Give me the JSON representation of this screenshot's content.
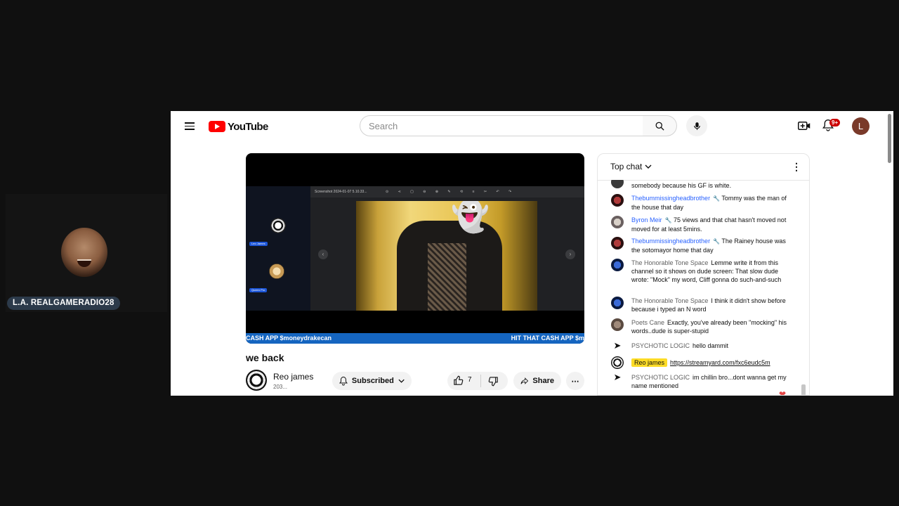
{
  "webcam": {
    "name": "L.A. REALGAMERADIO28"
  },
  "header": {
    "logo": "YouTube",
    "search_placeholder": "Search",
    "notifications": "9+",
    "avatar_letter": "L"
  },
  "video": {
    "screenshot_title": "Screenshot 2024-01-07 5.10.33...",
    "side_labels": [
      "Leo James",
      "Queen Pro"
    ],
    "ticker_left": "CASH APP $moneydrakecan",
    "ticker_right": "HIT THAT CASH APP $m",
    "title": "we back",
    "channel": "Reo james",
    "subs": "203...",
    "subscribe_label": "Subscribed",
    "likes": "7",
    "share_label": "Share"
  },
  "chat": {
    "title": "Top chat",
    "messages": [
      {
        "author": "",
        "text": "somebody because his GF is white."
      },
      {
        "author": "Thebummissingheadbrother",
        "mod": true,
        "text": "Tommy was the man of the house that day"
      },
      {
        "author": "Byron Meir",
        "mod": true,
        "text": "75 views and that chat hasn't moved not moved for at least 5mins."
      },
      {
        "author": "Thebummissingheadbrother",
        "mod": true,
        "text": "The Rainey house was the sotomayor home that day"
      },
      {
        "author": "The Honorable Tone Space",
        "text": "Lemme write it from this channel so it shows on dude screen: That slow dude wrote: \"Mock\" my word, Cliff gonna do such-and-such"
      },
      {
        "author": "The Honorable Tone Space",
        "text": "I think it didn't show before because i typed an N word"
      },
      {
        "author": "Poets Cane",
        "text": "Exactly, you've already been \"mocking\" his words..dude is super-stupid"
      },
      {
        "author": "PSYCHOTIC LOGIC",
        "text": "hello dammit"
      },
      {
        "author": "Reo james",
        "owner": true,
        "text": "https://streamyard.com/fxc6eudc5m"
      },
      {
        "author": "PSYCHOTIC LOGIC",
        "text": "im chillin bro...dont wanna get my name mentioned"
      }
    ]
  },
  "colors": {
    "brand": "#ff0000",
    "link": "#2962ff",
    "owner_highlight": "#fddc26",
    "ticker": "#1565c0"
  }
}
